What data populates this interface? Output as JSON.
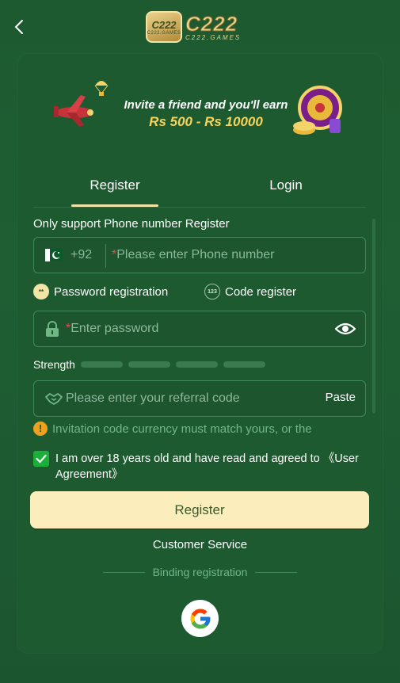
{
  "header": {
    "logo_badge": "C222",
    "logo_badge_sub": "C222.GAMES",
    "logo_text": "C222",
    "logo_sub": "C222.GAMES"
  },
  "banner": {
    "line1": "Invite a friend and you'll earn",
    "line2": "Rs 500 - Rs 10000"
  },
  "tabs": [
    {
      "label": "Register",
      "active": true
    },
    {
      "label": "Login",
      "active": false
    }
  ],
  "form": {
    "phone_label": "Only support Phone number Register",
    "country_code": "+92",
    "phone_placeholder": "Please enter Phone number",
    "required_mark": "*",
    "modes": [
      {
        "label": "Password registration",
        "selected": true,
        "icon": "**"
      },
      {
        "label": "Code register",
        "selected": false,
        "icon": "123"
      }
    ],
    "password_placeholder": "Enter password",
    "strength_label": "Strength",
    "strength_level": 0,
    "referral_placeholder": "Please enter your referral code",
    "paste_label": "Paste",
    "notice": "Invitation code currency must match yours, or the",
    "agree_text": "I am over 18 years old and have read and agreed to ",
    "agree_link": "《User Agreement》",
    "agree_checked": true,
    "register_label": "Register"
  },
  "footer": {
    "customer_service": "Customer Service",
    "binding_label": "Binding registration"
  },
  "colors": {
    "background": "#1f5a31",
    "accent": "#f2e3a7",
    "button": "#fbeebc",
    "muted_text": "#6fb886",
    "required": "#e25050",
    "checkbox": "#1bb03a",
    "warning": "#f0a020"
  },
  "icons": {
    "back": "chevron-left-icon",
    "flag": "pakistan-flag-icon",
    "lock": "lock-icon",
    "eye": "eye-icon",
    "referral": "handshake-icon",
    "warning": "warning-icon",
    "check": "check-icon",
    "google": "google-icon"
  }
}
